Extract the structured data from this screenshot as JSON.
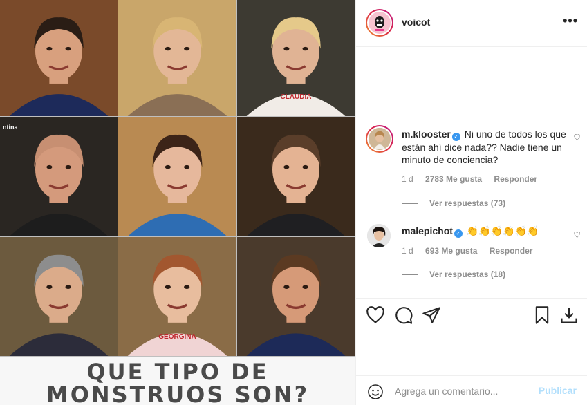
{
  "post": {
    "caption_line1": "QUE TIPO DE",
    "caption_line2": "MONSTRUOS SON?",
    "tile_tag": "ntina",
    "tiles": [
      {
        "name": "tile-laughing-man",
        "bg": "#7a4a2a",
        "face": "#d8a07e",
        "hair": "#2a1d15",
        "shirt": "#1d2a5a"
      },
      {
        "name": "tile-blonde-woman",
        "bg": "#c9a66a",
        "face": "#e3b796",
        "hair": "#d8b574",
        "shirt": "#8a6f55"
      },
      {
        "name": "tile-woman-holding-meat",
        "bg": "#3d3a32",
        "face": "#e0b394",
        "hair": "#e5c98a",
        "shirt": "#f1ece7",
        "apron_text": "CLAUDIA"
      },
      {
        "name": "tile-bald-man",
        "bg": "#2a2622",
        "face": "#d49a7c",
        "hair": "#c78f72",
        "shirt": "#1d1d1d"
      },
      {
        "name": "tile-woman-bandana",
        "bg": "#b98a52",
        "face": "#e6b89c",
        "hair": "#3c2418",
        "shirt": "#2e6db3"
      },
      {
        "name": "tile-smiling-man",
        "bg": "#3a2a1c",
        "face": "#e4b393",
        "hair": "#5a3e2a",
        "shirt": "#1f1f22"
      },
      {
        "name": "tile-man-red-glasses",
        "bg": "#6c5a3e",
        "face": "#dbab8a",
        "hair": "#8d8d8d",
        "shirt": "#2c2c3a"
      },
      {
        "name": "tile-woman-with-cat",
        "bg": "#8a6c47",
        "face": "#e8bd9e",
        "hair": "#a2572f",
        "shirt": "#f0d4d4",
        "apron_text": "GEORGINA"
      },
      {
        "name": "tile-surprised-man",
        "bg": "#4a3a2c",
        "face": "#d69a78",
        "hair": "#5b3a22",
        "shirt": "#1d2a58"
      }
    ]
  },
  "header": {
    "username": "voicot",
    "more_icon": "•••"
  },
  "comments": [
    {
      "username": "m.klooster",
      "text": "Ni uno de todos los que están ahí dice nada?? Nadie tiene un minuto de conciencia?",
      "time": "1 d",
      "likes": "2783 Me gusta",
      "reply_label": "Responder",
      "view_replies": "Ver respuestas (73)"
    },
    {
      "username": "malepichot",
      "text": "👏👏👏👏👏👏",
      "time": "1 d",
      "likes": "693 Me gusta",
      "reply_label": "Responder",
      "view_replies": "Ver respuestas (18)"
    }
  ],
  "add_comment": {
    "placeholder": "Agrega un comentario...",
    "publish_label": "Publicar"
  },
  "icons": {
    "like": "heart-icon",
    "comment": "comment-icon",
    "share": "share-icon",
    "save": "bookmark-icon",
    "download": "download-icon",
    "emoji": "emoji-icon"
  }
}
